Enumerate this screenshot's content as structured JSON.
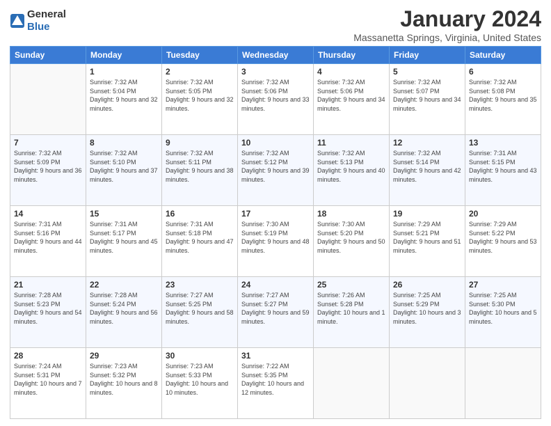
{
  "logo": {
    "general": "General",
    "blue": "Blue"
  },
  "title": "January 2024",
  "location": "Massanetta Springs, Virginia, United States",
  "weekdays": [
    "Sunday",
    "Monday",
    "Tuesday",
    "Wednesday",
    "Thursday",
    "Friday",
    "Saturday"
  ],
  "weeks": [
    [
      {
        "day": null,
        "sunrise": "",
        "sunset": "",
        "daylight": ""
      },
      {
        "day": "1",
        "sunrise": "Sunrise: 7:32 AM",
        "sunset": "Sunset: 5:04 PM",
        "daylight": "Daylight: 9 hours and 32 minutes."
      },
      {
        "day": "2",
        "sunrise": "Sunrise: 7:32 AM",
        "sunset": "Sunset: 5:05 PM",
        "daylight": "Daylight: 9 hours and 32 minutes."
      },
      {
        "day": "3",
        "sunrise": "Sunrise: 7:32 AM",
        "sunset": "Sunset: 5:06 PM",
        "daylight": "Daylight: 9 hours and 33 minutes."
      },
      {
        "day": "4",
        "sunrise": "Sunrise: 7:32 AM",
        "sunset": "Sunset: 5:06 PM",
        "daylight": "Daylight: 9 hours and 34 minutes."
      },
      {
        "day": "5",
        "sunrise": "Sunrise: 7:32 AM",
        "sunset": "Sunset: 5:07 PM",
        "daylight": "Daylight: 9 hours and 34 minutes."
      },
      {
        "day": "6",
        "sunrise": "Sunrise: 7:32 AM",
        "sunset": "Sunset: 5:08 PM",
        "daylight": "Daylight: 9 hours and 35 minutes."
      }
    ],
    [
      {
        "day": "7",
        "sunrise": "Sunrise: 7:32 AM",
        "sunset": "Sunset: 5:09 PM",
        "daylight": "Daylight: 9 hours and 36 minutes."
      },
      {
        "day": "8",
        "sunrise": "Sunrise: 7:32 AM",
        "sunset": "Sunset: 5:10 PM",
        "daylight": "Daylight: 9 hours and 37 minutes."
      },
      {
        "day": "9",
        "sunrise": "Sunrise: 7:32 AM",
        "sunset": "Sunset: 5:11 PM",
        "daylight": "Daylight: 9 hours and 38 minutes."
      },
      {
        "day": "10",
        "sunrise": "Sunrise: 7:32 AM",
        "sunset": "Sunset: 5:12 PM",
        "daylight": "Daylight: 9 hours and 39 minutes."
      },
      {
        "day": "11",
        "sunrise": "Sunrise: 7:32 AM",
        "sunset": "Sunset: 5:13 PM",
        "daylight": "Daylight: 9 hours and 40 minutes."
      },
      {
        "day": "12",
        "sunrise": "Sunrise: 7:32 AM",
        "sunset": "Sunset: 5:14 PM",
        "daylight": "Daylight: 9 hours and 42 minutes."
      },
      {
        "day": "13",
        "sunrise": "Sunrise: 7:31 AM",
        "sunset": "Sunset: 5:15 PM",
        "daylight": "Daylight: 9 hours and 43 minutes."
      }
    ],
    [
      {
        "day": "14",
        "sunrise": "Sunrise: 7:31 AM",
        "sunset": "Sunset: 5:16 PM",
        "daylight": "Daylight: 9 hours and 44 minutes."
      },
      {
        "day": "15",
        "sunrise": "Sunrise: 7:31 AM",
        "sunset": "Sunset: 5:17 PM",
        "daylight": "Daylight: 9 hours and 45 minutes."
      },
      {
        "day": "16",
        "sunrise": "Sunrise: 7:31 AM",
        "sunset": "Sunset: 5:18 PM",
        "daylight": "Daylight: 9 hours and 47 minutes."
      },
      {
        "day": "17",
        "sunrise": "Sunrise: 7:30 AM",
        "sunset": "Sunset: 5:19 PM",
        "daylight": "Daylight: 9 hours and 48 minutes."
      },
      {
        "day": "18",
        "sunrise": "Sunrise: 7:30 AM",
        "sunset": "Sunset: 5:20 PM",
        "daylight": "Daylight: 9 hours and 50 minutes."
      },
      {
        "day": "19",
        "sunrise": "Sunrise: 7:29 AM",
        "sunset": "Sunset: 5:21 PM",
        "daylight": "Daylight: 9 hours and 51 minutes."
      },
      {
        "day": "20",
        "sunrise": "Sunrise: 7:29 AM",
        "sunset": "Sunset: 5:22 PM",
        "daylight": "Daylight: 9 hours and 53 minutes."
      }
    ],
    [
      {
        "day": "21",
        "sunrise": "Sunrise: 7:28 AM",
        "sunset": "Sunset: 5:23 PM",
        "daylight": "Daylight: 9 hours and 54 minutes."
      },
      {
        "day": "22",
        "sunrise": "Sunrise: 7:28 AM",
        "sunset": "Sunset: 5:24 PM",
        "daylight": "Daylight: 9 hours and 56 minutes."
      },
      {
        "day": "23",
        "sunrise": "Sunrise: 7:27 AM",
        "sunset": "Sunset: 5:25 PM",
        "daylight": "Daylight: 9 hours and 58 minutes."
      },
      {
        "day": "24",
        "sunrise": "Sunrise: 7:27 AM",
        "sunset": "Sunset: 5:27 PM",
        "daylight": "Daylight: 9 hours and 59 minutes."
      },
      {
        "day": "25",
        "sunrise": "Sunrise: 7:26 AM",
        "sunset": "Sunset: 5:28 PM",
        "daylight": "Daylight: 10 hours and 1 minute."
      },
      {
        "day": "26",
        "sunrise": "Sunrise: 7:25 AM",
        "sunset": "Sunset: 5:29 PM",
        "daylight": "Daylight: 10 hours and 3 minutes."
      },
      {
        "day": "27",
        "sunrise": "Sunrise: 7:25 AM",
        "sunset": "Sunset: 5:30 PM",
        "daylight": "Daylight: 10 hours and 5 minutes."
      }
    ],
    [
      {
        "day": "28",
        "sunrise": "Sunrise: 7:24 AM",
        "sunset": "Sunset: 5:31 PM",
        "daylight": "Daylight: 10 hours and 7 minutes."
      },
      {
        "day": "29",
        "sunrise": "Sunrise: 7:23 AM",
        "sunset": "Sunset: 5:32 PM",
        "daylight": "Daylight: 10 hours and 8 minutes."
      },
      {
        "day": "30",
        "sunrise": "Sunrise: 7:23 AM",
        "sunset": "Sunset: 5:33 PM",
        "daylight": "Daylight: 10 hours and 10 minutes."
      },
      {
        "day": "31",
        "sunrise": "Sunrise: 7:22 AM",
        "sunset": "Sunset: 5:35 PM",
        "daylight": "Daylight: 10 hours and 12 minutes."
      },
      {
        "day": null,
        "sunrise": "",
        "sunset": "",
        "daylight": ""
      },
      {
        "day": null,
        "sunrise": "",
        "sunset": "",
        "daylight": ""
      },
      {
        "day": null,
        "sunrise": "",
        "sunset": "",
        "daylight": ""
      }
    ]
  ]
}
